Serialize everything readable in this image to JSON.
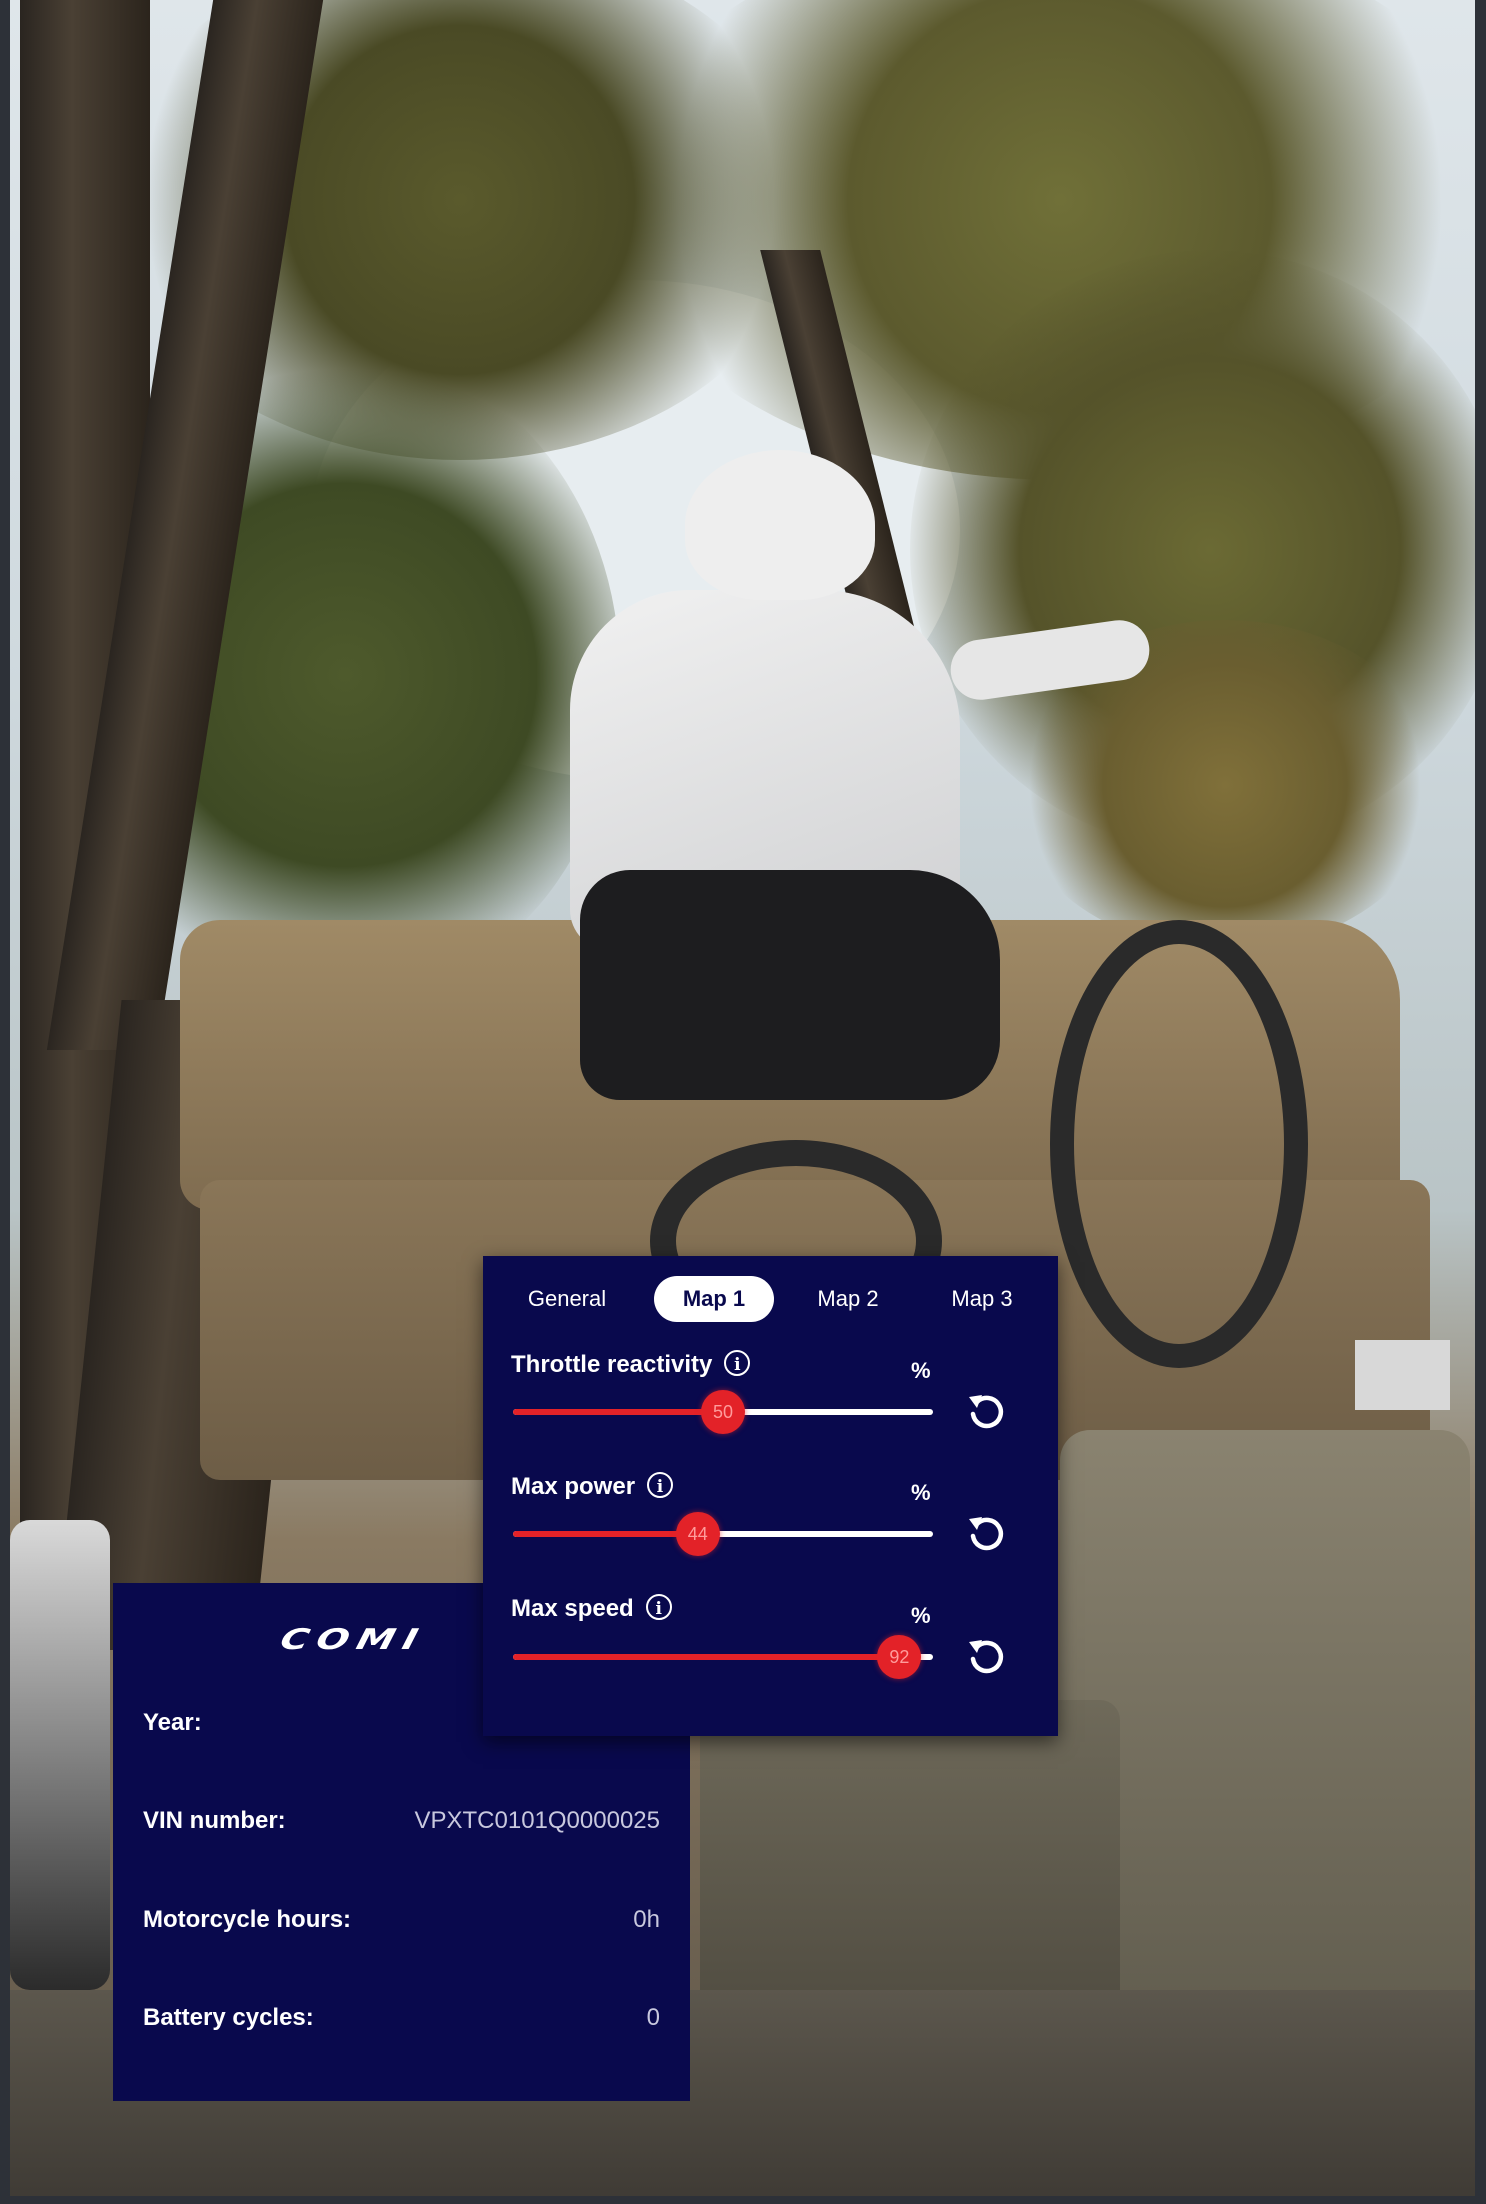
{
  "maps_panel": {
    "tabs": [
      {
        "label": "General",
        "active": false
      },
      {
        "label": "Map 1",
        "active": true
      },
      {
        "label": "Map 2",
        "active": false
      },
      {
        "label": "Map 3",
        "active": false
      }
    ],
    "settings": [
      {
        "label": "Throttle reactivity",
        "unit": "%",
        "value": 50,
        "value_text": "50",
        "info_icon": "info-icon",
        "reset_icon": "reset-icon"
      },
      {
        "label": "Max power",
        "unit": "%",
        "value": 44,
        "value_text": "44",
        "info_icon": "info-icon",
        "reset_icon": "reset-icon"
      },
      {
        "label": "Max speed",
        "unit": "%",
        "value": 92,
        "value_text": "92",
        "info_icon": "info-icon",
        "reset_icon": "reset-icon"
      }
    ],
    "colors": {
      "panel": "#09094d",
      "accent": "#e32228",
      "track": "#ffffff"
    }
  },
  "info_panel": {
    "brand": "COMI",
    "rows": [
      {
        "label": "Year:",
        "value": ""
      },
      {
        "label": "VIN number:",
        "value": "VPXTC0101Q0000025"
      },
      {
        "label": "Motorcycle hours:",
        "value": "0h"
      },
      {
        "label": "Battery cycles:",
        "value": "0"
      }
    ]
  },
  "info_glyph": "i"
}
